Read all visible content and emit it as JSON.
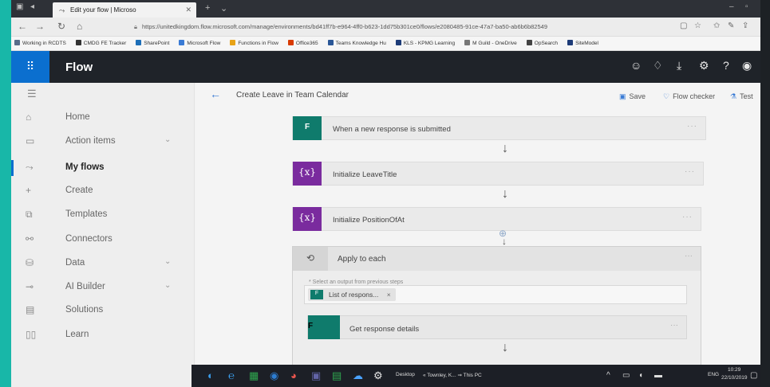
{
  "browser": {
    "tab_title": "Edit your flow | Microso",
    "url": "https://unitedkingdom.flow.microsoft.com/manage/environments/bd41ff7b-e964-4ff0-b623-1dd75b301ce0/flows/e2080485-91ce-47a7-ba50-ab6b6b82549",
    "favorites": [
      {
        "label": "Working in RCDTS",
        "color": "#5a6d8a"
      },
      {
        "label": "CMDG FE Tracker",
        "color": "#333333"
      },
      {
        "label": "SharePoint",
        "color": "#1d6fb8"
      },
      {
        "label": "Microsoft Flow",
        "color": "#3a7bd5"
      },
      {
        "label": "Functions in Flow",
        "color": "#e8a317"
      },
      {
        "label": "Office365",
        "color": "#d83b01"
      },
      {
        "label": "Teams Knowledge Hu",
        "color": "#2b5797"
      },
      {
        "label": "KLS - KPMG Learning",
        "color": "#1e3c78"
      },
      {
        "label": "M Guild - OneDrive",
        "color": "#777777"
      },
      {
        "label": "OpSearch",
        "color": "#444444"
      },
      {
        "label": "SiteModel",
        "color": "#1e3c78"
      }
    ]
  },
  "app": {
    "name": "Flow",
    "accent": "#0b6fcf"
  },
  "nav": {
    "items": [
      {
        "label": "Home",
        "icon": "home-icon",
        "glyph": "⌂",
        "chevron": false,
        "active": false
      },
      {
        "label": "Action items",
        "icon": "clipboard-icon",
        "glyph": "▭",
        "chevron": true,
        "active": false
      },
      {
        "label": "My flows",
        "icon": "flow-icon",
        "glyph": "⤳",
        "chevron": false,
        "active": true
      },
      {
        "label": "Create",
        "icon": "plus-icon",
        "glyph": "+",
        "chevron": false,
        "active": false
      },
      {
        "label": "Templates",
        "icon": "templates-icon",
        "glyph": "⧉",
        "chevron": false,
        "active": false
      },
      {
        "label": "Connectors",
        "icon": "connectors-icon",
        "glyph": "⚯",
        "chevron": false,
        "active": false
      },
      {
        "label": "Data",
        "icon": "database-icon",
        "glyph": "⛁",
        "chevron": true,
        "active": false
      },
      {
        "label": "AI Builder",
        "icon": "ai-builder-icon",
        "glyph": "⊸",
        "chevron": true,
        "active": false
      },
      {
        "label": "Solutions",
        "icon": "solutions-icon",
        "glyph": "▤",
        "chevron": false,
        "active": false
      },
      {
        "label": "Learn",
        "icon": "book-icon",
        "glyph": "▯▯",
        "chevron": false,
        "active": false
      }
    ]
  },
  "editor": {
    "title": "Create Leave in Team Calendar",
    "save_label": "Save",
    "checker_label": "Flow checker",
    "test_label": "Test",
    "steps": {
      "trigger": "When a new response is submitted",
      "init1": "Initialize LeaveTitle",
      "init2": "Initialize PositionOfAt",
      "apply": "Apply to each",
      "select_hint": "* Select an output from previous steps",
      "token": "List of respons...",
      "token_close": "×",
      "get_details": "Get response details"
    },
    "forms_badge": "F",
    "var_badge": "{x}"
  },
  "taskbar": {
    "desktop_label": "Desktop",
    "path_label": "« Townley, K...  ⇒ This PC",
    "lang": "ENG",
    "time": "10:29",
    "date": "22/10/2019"
  }
}
